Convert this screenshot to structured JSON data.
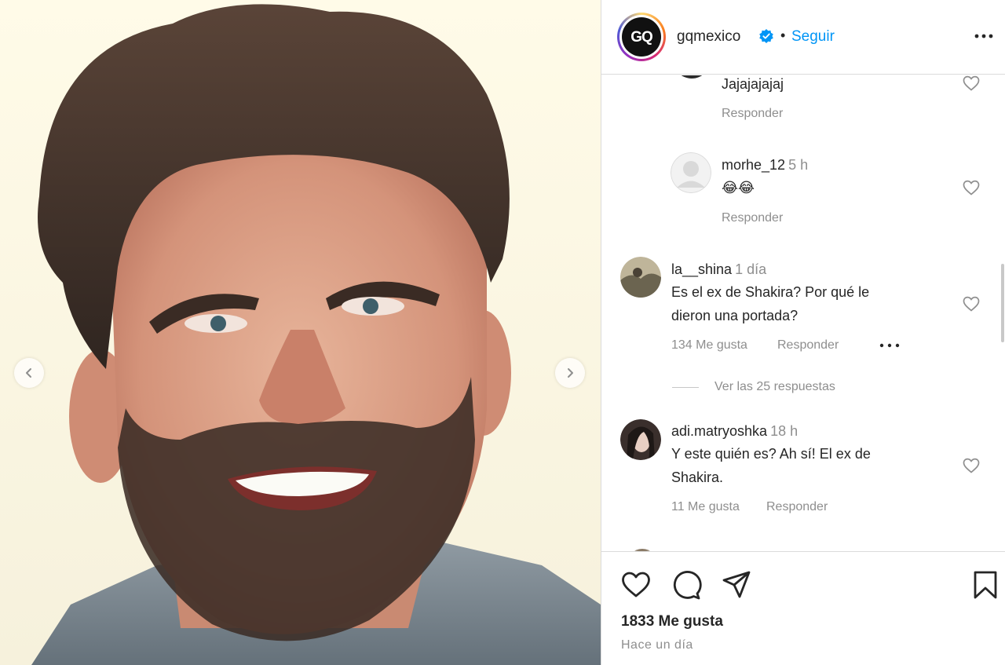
{
  "post": {
    "account": "gqmexico",
    "avatar_text": "GQ",
    "separator": "•",
    "follow_label": "Seguir",
    "likes_label": "1833 Me gusta",
    "time_ago": "Hace un día"
  },
  "comments": [
    {
      "text": "Jajajajajaj",
      "reply_label": "Responder"
    },
    {
      "username": "morhe_12",
      "time": "5 h",
      "text": "😂😂",
      "reply_label": "Responder"
    },
    {
      "username": "la__shina",
      "time": "1 día",
      "text_line1": "Es el ex de Shakira? Por qué le",
      "text_line2": "dieron una portada?",
      "likes_label": "134 Me gusta",
      "reply_label": "Responder",
      "view_replies": "Ver las 25 respuestas"
    },
    {
      "username": "adi.matryoshka",
      "time": "18 h",
      "text_line1": "Y este quién es? Ah sí! El ex de",
      "text_line2": "Shakira.",
      "likes_label": "11 Me gusta",
      "reply_label": "Responder"
    }
  ],
  "icons": {
    "prev": "chevron-left-icon",
    "next": "chevron-right-icon",
    "verified": "verified-badge-icon",
    "more": "more-options-icon",
    "like": "heart-icon",
    "comment": "comment-icon",
    "share": "share-icon",
    "save": "bookmark-icon"
  },
  "colors": {
    "accent": "#0095f6",
    "text": "#262626",
    "muted": "#8e8e8e",
    "border": "#dbdbdb"
  }
}
